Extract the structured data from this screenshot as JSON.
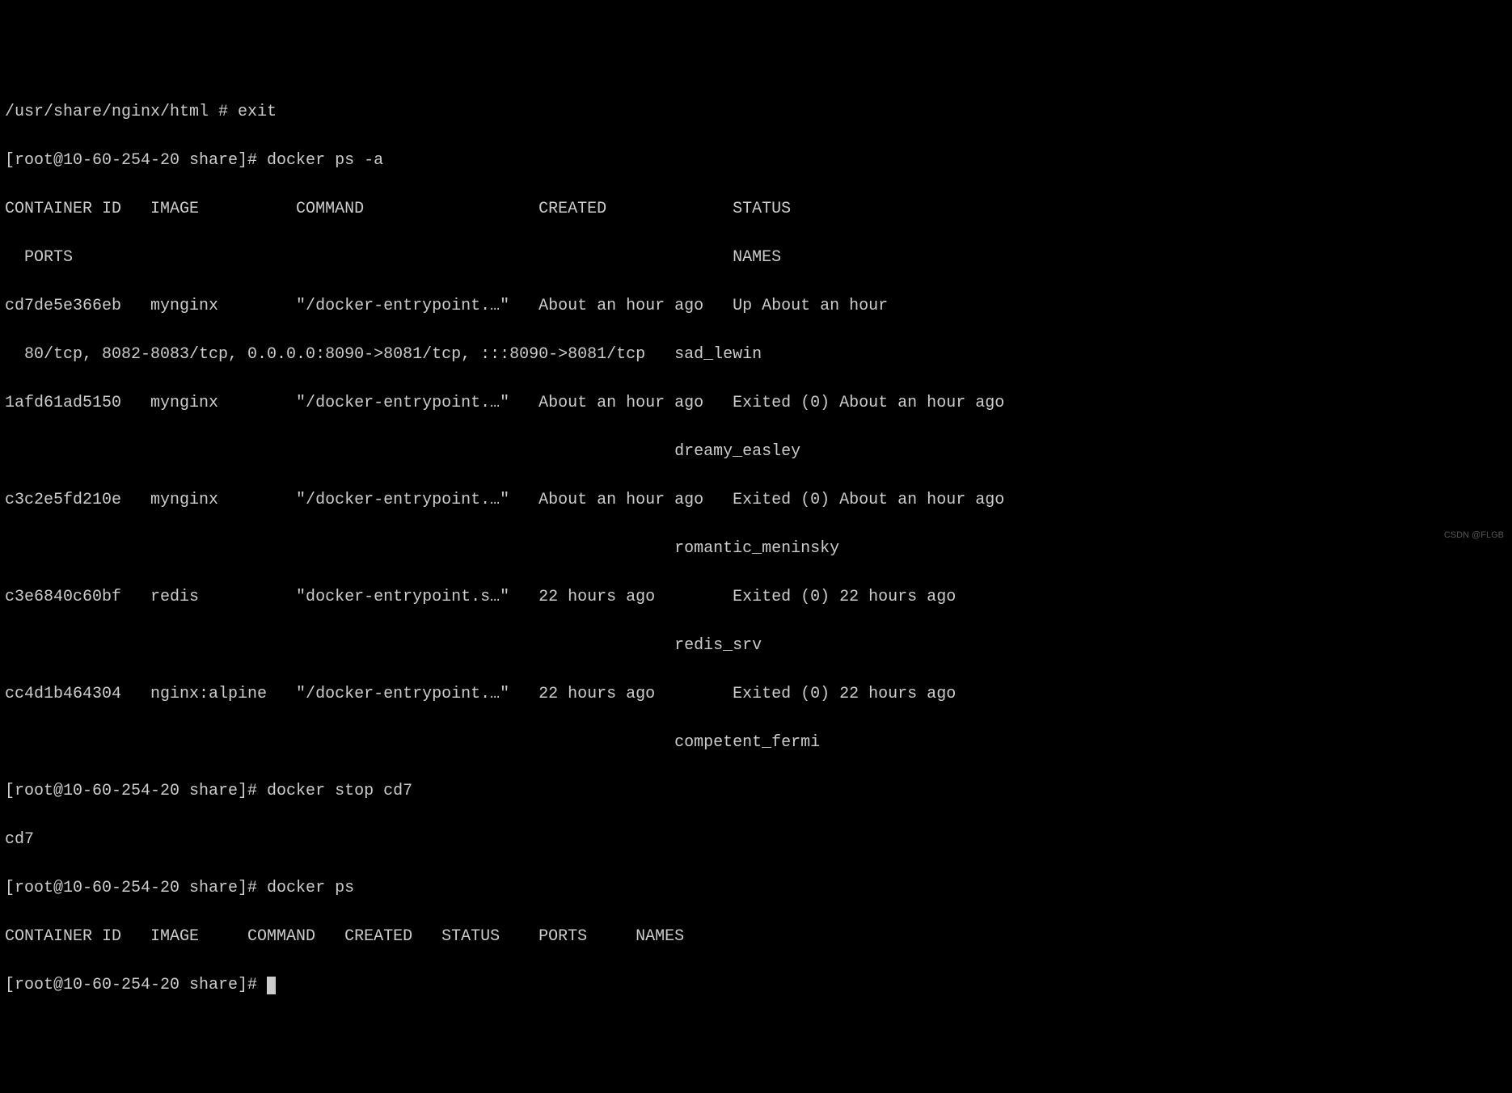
{
  "lines": {
    "l01": "/usr/share/nginx/html # exit",
    "l02": "[root@10-60-254-20 share]# docker ps -a",
    "l03": "CONTAINER ID   IMAGE          COMMAND                  CREATED             STATUS",
    "l04": "  PORTS                                                                    NAMES",
    "l05": "cd7de5e366eb   mynginx        \"/docker-entrypoint.…\"   About an hour ago   Up About an hour",
    "l06": "  80/tcp, 8082-8083/tcp, 0.0.0.0:8090->8081/tcp, :::8090->8081/tcp   sad_lewin",
    "l07": "1afd61ad5150   mynginx        \"/docker-entrypoint.…\"   About an hour ago   Exited (0) About an hour ago",
    "l08": "                                                                     dreamy_easley",
    "l09": "c3c2e5fd210e   mynginx        \"/docker-entrypoint.…\"   About an hour ago   Exited (0) About an hour ago",
    "l10": "                                                                     romantic_meninsky",
    "l11": "c3e6840c60bf   redis          \"docker-entrypoint.s…\"   22 hours ago        Exited (0) 22 hours ago",
    "l12": "                                                                     redis_srv",
    "l13": "cc4d1b464304   nginx:alpine   \"/docker-entrypoint.…\"   22 hours ago        Exited (0) 22 hours ago",
    "l14": "                                                                     competent_fermi",
    "l15": "[root@10-60-254-20 share]# docker stop cd7",
    "l16": "cd7",
    "l17": "[root@10-60-254-20 share]# docker ps",
    "l18": "CONTAINER ID   IMAGE     COMMAND   CREATED   STATUS    PORTS     NAMES",
    "l19": "[root@10-60-254-20 share]# "
  },
  "watermark": "CSDN @FLGB",
  "containers": [
    {
      "id": "cd7de5e366eb",
      "image": "mynginx",
      "command": "\"/docker-entrypoint.…\"",
      "created": "About an hour ago",
      "status": "Up About an hour",
      "ports": "80/tcp, 8082-8083/tcp, 0.0.0.0:8090->8081/tcp, :::8090->8081/tcp",
      "name": "sad_lewin"
    },
    {
      "id": "1afd61ad5150",
      "image": "mynginx",
      "command": "\"/docker-entrypoint.…\"",
      "created": "About an hour ago",
      "status": "Exited (0) About an hour ago",
      "ports": "",
      "name": "dreamy_easley"
    },
    {
      "id": "c3c2e5fd210e",
      "image": "mynginx",
      "command": "\"/docker-entrypoint.…\"",
      "created": "About an hour ago",
      "status": "Exited (0) About an hour ago",
      "ports": "",
      "name": "romantic_meninsky"
    },
    {
      "id": "c3e6840c60bf",
      "image": "redis",
      "command": "\"docker-entrypoint.s…\"",
      "created": "22 hours ago",
      "status": "Exited (0) 22 hours ago",
      "ports": "",
      "name": "redis_srv"
    },
    {
      "id": "cc4d1b464304",
      "image": "nginx:alpine",
      "command": "\"/docker-entrypoint.…\"",
      "created": "22 hours ago",
      "status": "Exited (0) 22 hours ago",
      "ports": "",
      "name": "competent_fermi"
    }
  ],
  "commands": [
    {
      "prompt": "/usr/share/nginx/html #",
      "cmd": "exit"
    },
    {
      "prompt": "[root@10-60-254-20 share]#",
      "cmd": "docker ps -a"
    },
    {
      "prompt": "[root@10-60-254-20 share]#",
      "cmd": "docker stop cd7"
    },
    {
      "prompt": "[root@10-60-254-20 share]#",
      "cmd": "docker ps"
    },
    {
      "prompt": "[root@10-60-254-20 share]#",
      "cmd": ""
    }
  ]
}
